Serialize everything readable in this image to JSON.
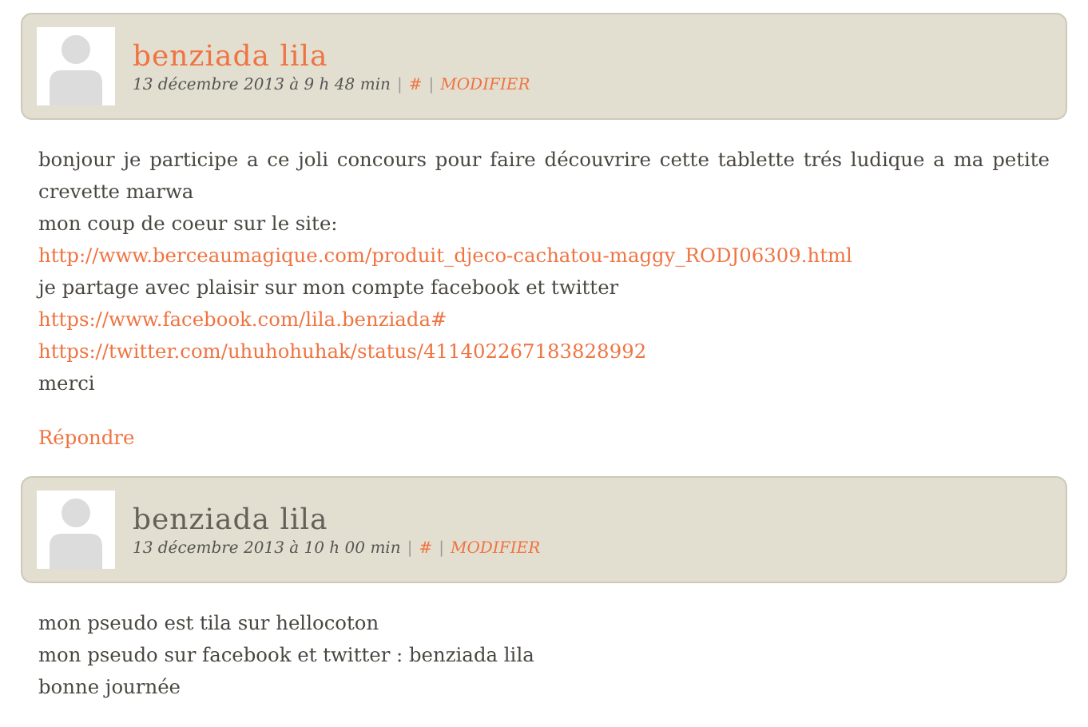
{
  "comments": [
    {
      "author": "benziada lila",
      "author_link": true,
      "date": "13 décembre 2013 à 9 h 48 min",
      "separator": "|",
      "permalink": "#",
      "edit": "MODIFIER",
      "lines": [
        {
          "kind": "text",
          "text": "bonjour je participe a ce joli concours pour faire découvrire cette tablette trés ludique a ma petite crevette marwa"
        },
        {
          "kind": "text",
          "text": "mon coup de coeur sur le site:"
        },
        {
          "kind": "link",
          "text": "http://www.berceaumagique.com/produit_djeco-cachatou-maggy_RODJ06309.html"
        },
        {
          "kind": "text",
          "text": "je partage avec plaisir sur mon compte facebook et twitter"
        },
        {
          "kind": "link",
          "text": "https://www.facebook.com/lila.benziada#"
        },
        {
          "kind": "link",
          "text": "https://twitter.com/uhuhohuhak/status/411402267183828992"
        },
        {
          "kind": "text",
          "text": "merci"
        }
      ],
      "reply": "Répondre"
    },
    {
      "author": "benziada lila",
      "author_link": false,
      "date": "13 décembre 2013 à 10 h 00 min",
      "separator": "|",
      "permalink": "#",
      "edit": "MODIFIER",
      "lines": [
        {
          "kind": "text",
          "text": "mon pseudo est tila sur hellocoton"
        },
        {
          "kind": "text",
          "text": "mon pseudo sur facebook et twitter : benziada lila"
        },
        {
          "kind": "text",
          "text": "bonne journée"
        }
      ]
    }
  ]
}
